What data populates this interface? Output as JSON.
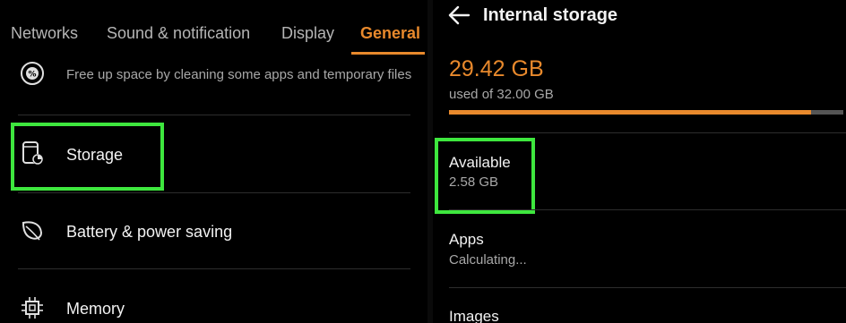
{
  "settings": {
    "tabs": [
      {
        "label": "Networks"
      },
      {
        "label": "Sound & notification"
      },
      {
        "label": "Display"
      },
      {
        "label": "General"
      }
    ],
    "active_tab": "General",
    "rows": [
      {
        "title": "",
        "subtitle": "Free up space by cleaning some apps and temporary files",
        "icon": "cleanup-icon"
      },
      {
        "title": "Storage",
        "subtitle": "",
        "icon": "storage-icon"
      },
      {
        "title": "Battery & power saving",
        "subtitle": "",
        "icon": "leaf-icon"
      },
      {
        "title": "Memory",
        "subtitle": "",
        "icon": "chip-icon"
      }
    ]
  },
  "storage": {
    "title": "Internal storage",
    "used_size": "29.42 GB",
    "used_of": "used of 32.00 GB",
    "used_fraction": 0.919,
    "items": [
      {
        "title": "Available",
        "value": "2.58 GB"
      },
      {
        "title": "Apps",
        "value": "Calculating..."
      },
      {
        "title": "Images",
        "value": ""
      }
    ]
  },
  "colors": {
    "accent": "#e8892c",
    "highlight": "#3ee73e",
    "background": "#000000"
  }
}
